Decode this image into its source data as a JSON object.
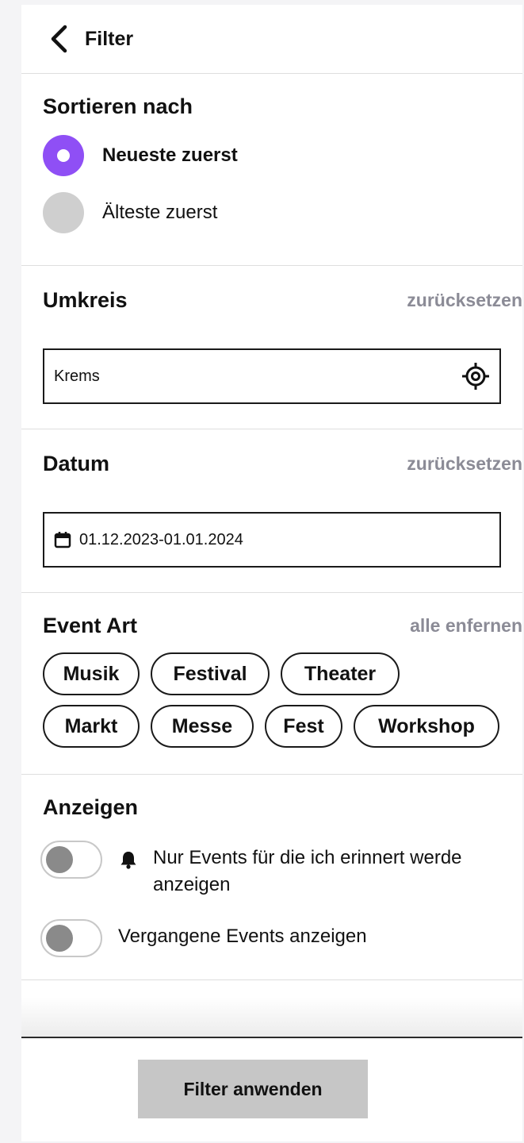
{
  "header": {
    "title": "Filter",
    "back_icon": "chevron-left-icon"
  },
  "sort": {
    "title": "Sortieren nach",
    "options": [
      {
        "label": "Neueste zuerst",
        "selected": true
      },
      {
        "label": "Älteste zuerst",
        "selected": false
      }
    ],
    "accent_color": "#8f4ff5"
  },
  "radius": {
    "title": "Umkreis",
    "reset_label": "zurücksetzen",
    "location_value": "Krems",
    "locate_icon": "crosshair-icon"
  },
  "date": {
    "title": "Datum",
    "reset_label": "zurücksetzen",
    "range_value": "01.12.2023-01.01.2024",
    "calendar_icon": "calendar-icon"
  },
  "event_type": {
    "title": "Event Art",
    "clear_label": "alle enfernen",
    "chips_row1": [
      "Musik",
      "Festival",
      "Theater"
    ],
    "chips_row2": [
      "Markt",
      "Messe",
      "Fest",
      "Workshop"
    ]
  },
  "display": {
    "title": "Anzeigen",
    "reminder_label": "Nur Events für die ich erinnert werde anzeigen",
    "reminder_on": false,
    "reminder_icon": "bell-icon",
    "past_label": "Vergangene Events anzeigen",
    "past_on": false
  },
  "footer": {
    "apply_label": "Filter anwenden"
  }
}
